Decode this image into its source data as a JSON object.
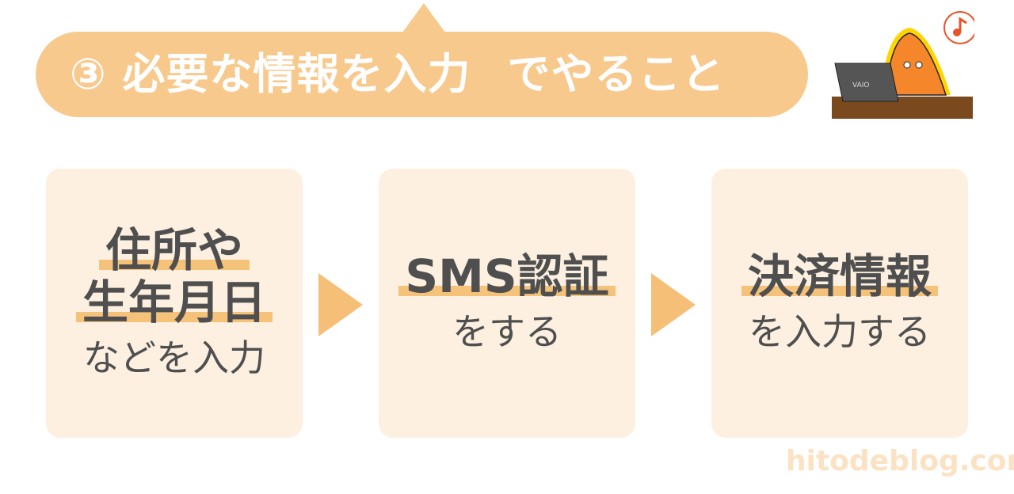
{
  "header": {
    "number": "③",
    "title": "必要な情報を入力",
    "suffix": "でやること"
  },
  "steps": [
    {
      "lines": [
        "住所や",
        "生年月日"
      ],
      "sub": "などを入力"
    },
    {
      "lines": [
        "SMS認証"
      ],
      "sub": "をする"
    },
    {
      "lines": [
        "決済情報"
      ],
      "sub": "を入力する"
    }
  ],
  "mascot": {
    "laptop_logo": "VAIO",
    "bubble_icon": "music-note-icon"
  },
  "watermark": "hitodeblog.com",
  "colors": {
    "accent": "#f8c98c",
    "box": "#fdf0e0",
    "text": "#4f4f4f",
    "highlight": "#f5c27a"
  }
}
